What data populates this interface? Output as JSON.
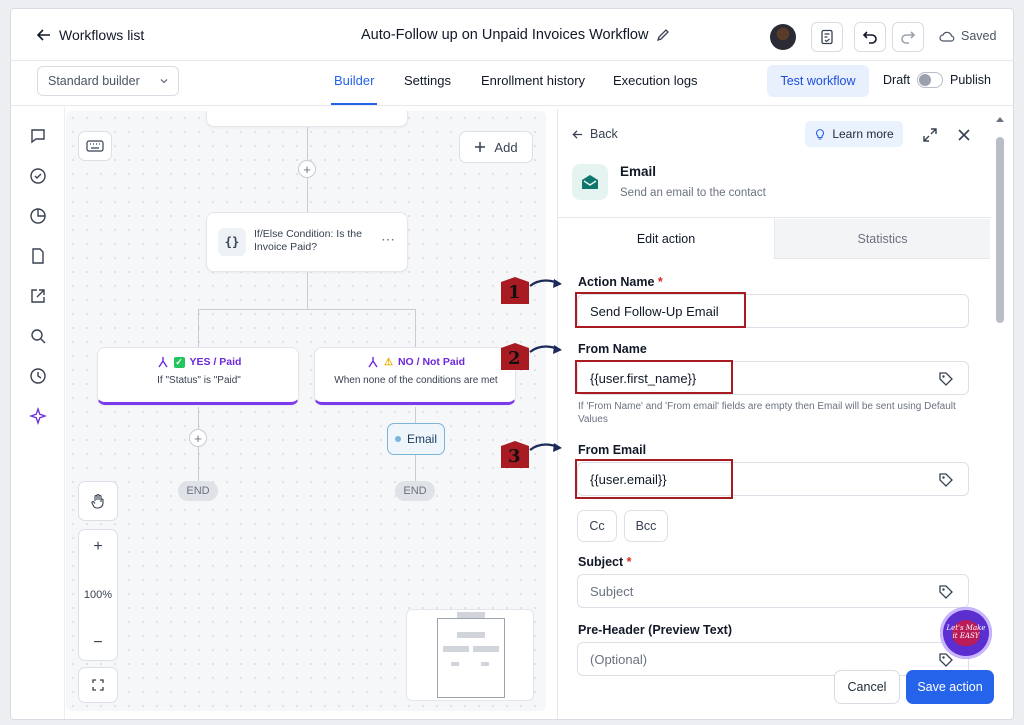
{
  "topbar": {
    "back_label": "Workflows list",
    "workflow_title": "Auto-Follow up on Unpaid Invoices Workflow",
    "saved_label": "Saved"
  },
  "subbar": {
    "builder_mode": "Standard builder",
    "tabs": [
      "Builder",
      "Settings",
      "Enrollment history",
      "Execution logs"
    ],
    "active_tab": "Builder",
    "test_workflow_label": "Test workflow",
    "draft_label": "Draft",
    "publish_label": "Publish"
  },
  "canvas": {
    "add_label": "Add",
    "condition_node": {
      "title": "If/Else Condition: Is the Invoice Paid?"
    },
    "branch_yes": {
      "title": "YES / Paid",
      "desc": "If \"Status\" is \"Paid\""
    },
    "branch_no": {
      "title": "NO / Not Paid",
      "desc": "When none of the conditions are met"
    },
    "email_node_label": "Email",
    "end_label": "END",
    "zoom_label": "100%"
  },
  "panel": {
    "back_label": "Back",
    "learn_more_label": "Learn more",
    "action_title": "Email",
    "action_desc": "Send an email to the contact",
    "tabs": [
      "Edit action",
      "Statistics"
    ],
    "active_tab": "Edit action",
    "action_name_label": "Action Name",
    "action_name_value": "Send Follow-Up Email",
    "from_name_label": "From Name",
    "from_name_value": "{{user.first_name}}",
    "hint_text": "If 'From Name' and 'From email' fields are empty then Email will be sent using Default Values",
    "from_email_label": "From Email",
    "from_email_value": "{{user.email}}",
    "cc_label": "Cc",
    "bcc_label": "Bcc",
    "subject_label": "Subject",
    "subject_placeholder": "Subject",
    "preheader_label": "Pre-Header (Preview Text)",
    "preheader_placeholder": "(Optional)",
    "cancel_label": "Cancel",
    "save_label": "Save action"
  },
  "annotations": {
    "markers": [
      "1",
      "2",
      "3"
    ]
  },
  "watermark": {
    "text": "Let's Make it EASY"
  },
  "colors": {
    "accent": "#2563eb",
    "annotation_red": "#a81b22",
    "branch_purple": "#7c3aed",
    "email_green": "#0f766e"
  }
}
